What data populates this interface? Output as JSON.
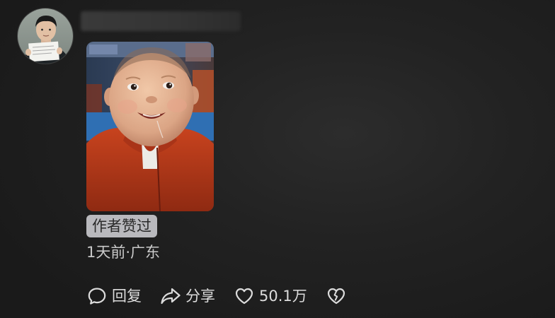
{
  "comment": {
    "username": "",
    "badge": "作者赞过",
    "meta": "1天前·广东",
    "photo_subject": "smiling baby in red jacket",
    "actions": {
      "reply": {
        "label": "回复",
        "icon": "speech-bubble-icon"
      },
      "share": {
        "label": "分享",
        "icon": "share-arrow-icon"
      },
      "like": {
        "label": "50.1万",
        "icon": "heart-icon"
      },
      "dislike": {
        "label": "",
        "icon": "broken-heart-icon"
      }
    }
  },
  "colors": {
    "background": "#222222",
    "badge_background": "#b9b9bd",
    "badge_text": "#2a2a2a",
    "text_primary": "#dcdcdc",
    "text_secondary": "#c9c9c9"
  }
}
